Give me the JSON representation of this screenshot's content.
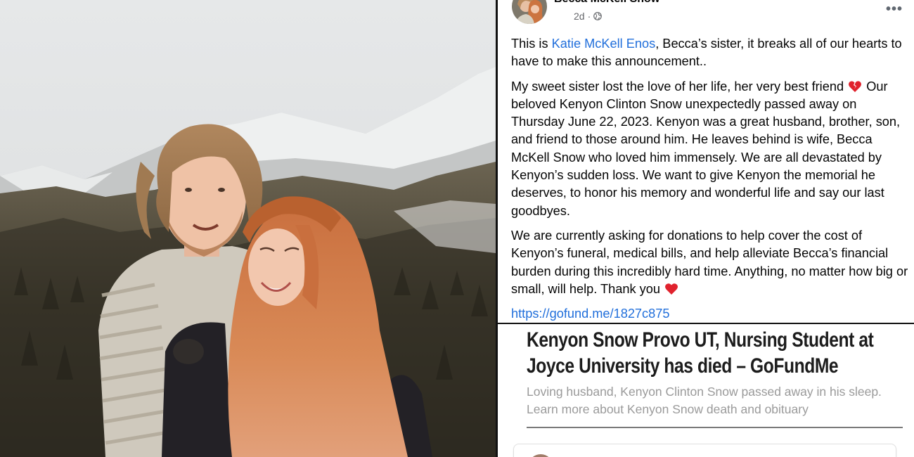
{
  "post": {
    "author": "Becca McKell Snow",
    "time": "2d",
    "visibility_icon": "globe-icon",
    "menu_icon": "more-options-icon",
    "more_label": "•••",
    "p1_intro": "This is ",
    "p1_mention": "Katie McKell Enos",
    "p1_rest": ", Becca’s sister, it breaks all of our hearts to have to make this announcement..",
    "p2_a": "My sweet sister lost the love of her life, her very best friend",
    "p2_b": " Our beloved Kenyon Clinton Snow unexpectedly passed away on Thursday June 22, 2023. Kenyon was a great husband, brother, son, and friend to those around him. He leaves behind is wife, Becca McKell Snow who loved him immensely.  We are all devastated by Kenyon’s sudden loss. We want to give Kenyon the memorial he deserves, to honor his memory and wonderful life and say our last goodbyes.",
    "p3": "We are currently asking for donations to help cover the cost of Kenyon’s funeral, medical bills, and help alleviate Becca’s financial burden during this incredibly hard time. Anything, no matter how big or small, will help. Thank you",
    "link": "https://gofund.me/1827c875",
    "emoji_broken_heart": "broken-heart-icon",
    "emoji_heart": "red-heart-icon"
  },
  "article": {
    "title": "Kenyon Snow Provo UT, Nursing Student at Joyce University has died – GoFundMe",
    "description": "Loving husband, Kenyon Clinton Snow passed away in his sleep. Learn more about Kenyon Snow death and obituary"
  },
  "colors": {
    "link": "#216fdb",
    "text": "#050505",
    "meta": "#65676b",
    "heart": "#e0222d"
  }
}
